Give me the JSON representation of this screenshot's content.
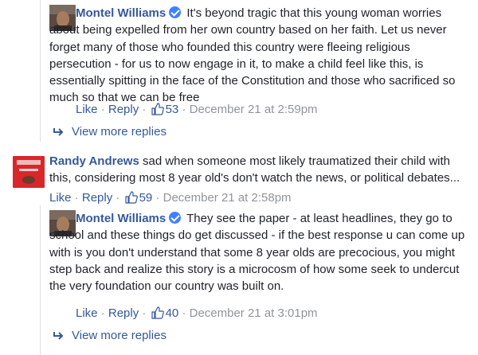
{
  "comments": [
    {
      "author": "Montel Williams",
      "verified": true,
      "text": "It's beyond tragic that this young woman worries about being expelled from her own country based on her faith. Let us never forget many of those who founded this country were fleeing religious persecution - for us to now engage in it, to make a child feel like this, is essentially spitting in the face of the Constitution and those who sacrificed so much so that we can be free",
      "like_label": "Like",
      "reply_label": "Reply",
      "likes": "53",
      "timestamp": "December 21 at 2:59pm"
    },
    {
      "author": "Randy Andrews",
      "verified": false,
      "text": "sad when someone most likely traumatized their child with this, considering most 8 year old's don't watch the news, or political debates...",
      "like_label": "Like",
      "reply_label": "Reply",
      "likes": "59",
      "timestamp": "December 21 at 2:58pm"
    },
    {
      "author": "Montel Williams",
      "verified": true,
      "text": "They see the paper - at least headlines, they go to school and these things do get discussed - if the best response u can come up with is you don't understand that some 8 year olds are precocious, you might step back and realize this story is a microcosm of how some seek to undercut the very foundation our country was built on.",
      "like_label": "Like",
      "reply_label": "Reply",
      "likes": "40",
      "timestamp": "December 21 at 3:01pm"
    }
  ],
  "view_more_label": "View more replies",
  "separator": "·",
  "colors": {
    "link": "#365899",
    "meta": "#90949c",
    "text": "#1d2129",
    "verified": "#4080ff"
  }
}
